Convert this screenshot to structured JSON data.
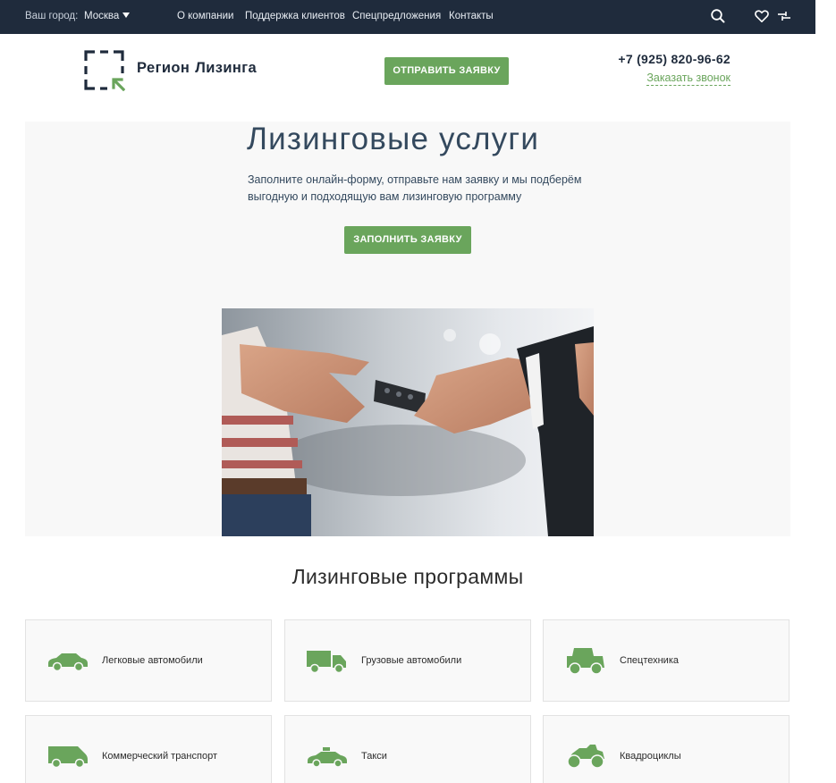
{
  "topbar": {
    "city_label": "Ваш город:",
    "city_value": "Москва",
    "nav": [
      "О компании",
      "Поддержка клиентов",
      "Спецпредложения",
      "Контакты"
    ],
    "icons": [
      "search-icon",
      "heart-icon",
      "compare-icon"
    ]
  },
  "header": {
    "brand_word1": "Регион",
    "brand_word2": "Лизинга",
    "send_button": "ОТПРАВИТЬ ЗАЯВКУ",
    "phone": "+7 (925) 820-96-62",
    "callback": "Заказать звонок"
  },
  "hero": {
    "title": "Лизинговые услуги",
    "lead": "Заполните онлайн-форму, отправьте нам заявку и мы подберём выгодную и подходящую вам лизинговую программу",
    "fill_button": "ЗАПОЛНИТЬ ЗАЯВКУ"
  },
  "programs": {
    "title": "Лизинговые программы",
    "items": [
      {
        "label": "Легковые автомобили",
        "icon": "car-icon"
      },
      {
        "label": "Грузовые автомобили",
        "icon": "truck-icon"
      },
      {
        "label": "Спецтехника",
        "icon": "tractor-icon"
      },
      {
        "label": "Коммерческий транспорт",
        "icon": "van-icon"
      },
      {
        "label": "Такси",
        "icon": "taxi-icon"
      },
      {
        "label": "Квадроциклы",
        "icon": "atv-icon"
      }
    ]
  },
  "colors": {
    "topbar": "#1f2b3c",
    "accent": "#6aa55c",
    "text_dark": "#34495e",
    "hero_bg": "#f8f8f8"
  }
}
